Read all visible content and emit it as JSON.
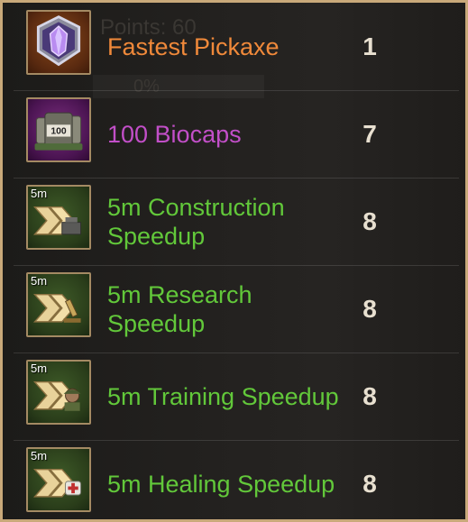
{
  "background": {
    "ghost_title": "Points: 60",
    "ghost_percent": "0%"
  },
  "colors": {
    "orange": "#f0893a",
    "purple": "#c24fc8",
    "green": "#62c83a",
    "qty": "#e8e0d0",
    "frame": "#c9a97a"
  },
  "rewards": [
    {
      "name": "Fastest Pickaxe",
      "quantity": "1",
      "color": "orange",
      "icon": "pickaxe-gem-icon",
      "badge": ""
    },
    {
      "name": "100 Biocaps",
      "quantity": "7",
      "color": "purple",
      "icon": "biocaps-icon",
      "badge": "",
      "icon_label": "100"
    },
    {
      "name": "5m Construction Speedup",
      "quantity": "8",
      "color": "green",
      "icon": "construction-speedup-icon",
      "badge": "5m"
    },
    {
      "name": "5m Research Speedup",
      "quantity": "8",
      "color": "green",
      "icon": "research-speedup-icon",
      "badge": "5m"
    },
    {
      "name": "5m Training Speedup",
      "quantity": "8",
      "color": "green",
      "icon": "training-speedup-icon",
      "badge": "5m"
    },
    {
      "name": "5m Healing Speedup",
      "quantity": "8",
      "color": "green",
      "icon": "healing-speedup-icon",
      "badge": "5m"
    }
  ]
}
